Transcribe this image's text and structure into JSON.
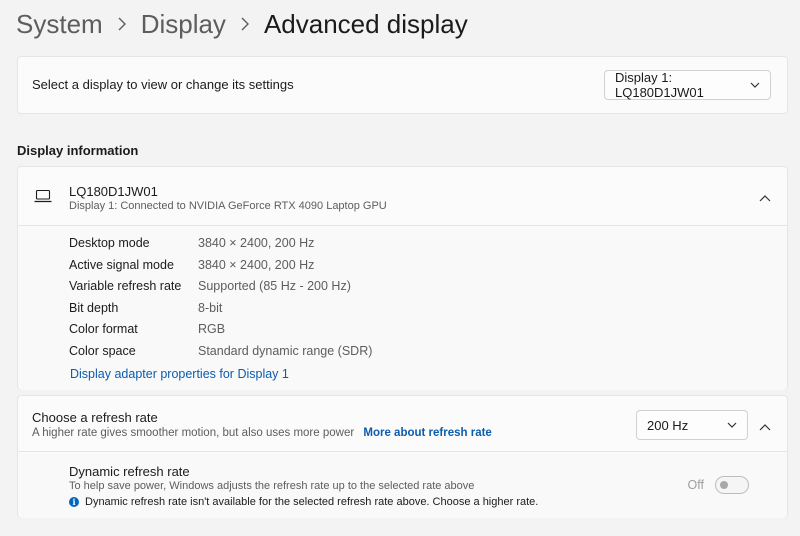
{
  "breadcrumb": {
    "items": [
      "System",
      "Display",
      "Advanced display"
    ]
  },
  "select_display": {
    "label": "Select a display to view or change its settings",
    "selected": "Display 1: LQ180D1JW01"
  },
  "display_info": {
    "section_title": "Display information",
    "name": "LQ180D1JW01",
    "subtitle": "Display 1: Connected to NVIDIA GeForce RTX 4090 Laptop GPU",
    "rows": [
      {
        "key": "Desktop mode",
        "value": "3840 × 2400, 200 Hz"
      },
      {
        "key": "Active signal mode",
        "value": "3840 × 2400, 200 Hz"
      },
      {
        "key": "Variable refresh rate",
        "value": "Supported (85 Hz - 200 Hz)"
      },
      {
        "key": "Bit depth",
        "value": "8-bit"
      },
      {
        "key": "Color format",
        "value": "RGB"
      },
      {
        "key": "Color space",
        "value": "Standard dynamic range (SDR)"
      }
    ],
    "adapter_link": "Display adapter properties for Display 1"
  },
  "refresh": {
    "title": "Choose a refresh rate",
    "subtitle": "A higher rate gives smoother motion, but also uses more power",
    "link": "More about refresh rate",
    "selected": "200 Hz"
  },
  "dynamic_refresh": {
    "title": "Dynamic refresh rate",
    "subtitle": "To help save power, Windows adjusts the refresh rate up to the selected rate above",
    "warning": "Dynamic refresh rate isn't available for the selected refresh rate above. Choose a higher rate.",
    "toggle_state": "Off"
  }
}
